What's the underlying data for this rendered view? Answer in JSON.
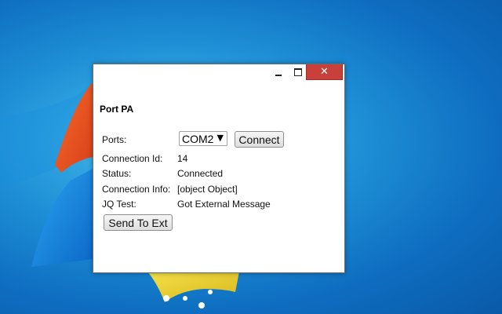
{
  "window": {
    "title": "Port PA",
    "controls": {
      "minimize_icon": "minimize-icon",
      "maximize_icon": "maximize-icon",
      "close_icon": "close-icon",
      "close_glyph": "✕"
    }
  },
  "form": {
    "ports_label": "Ports:",
    "ports_selected": "COM2",
    "dropdown_arrow": "▼",
    "connect_label": "Connect",
    "connection_id_label": "Connection Id:",
    "connection_id_value": "14",
    "status_label": "Status:",
    "status_value": "Connected",
    "connection_info_label": "Connection Info:",
    "connection_info_value": "[object Object]",
    "jq_test_label": "JQ Test:",
    "jq_test_value": "Got External Message",
    "send_label": "Send To Ext"
  },
  "colors": {
    "close_button": "#c9403a",
    "desktop": "#1e8fd6"
  }
}
